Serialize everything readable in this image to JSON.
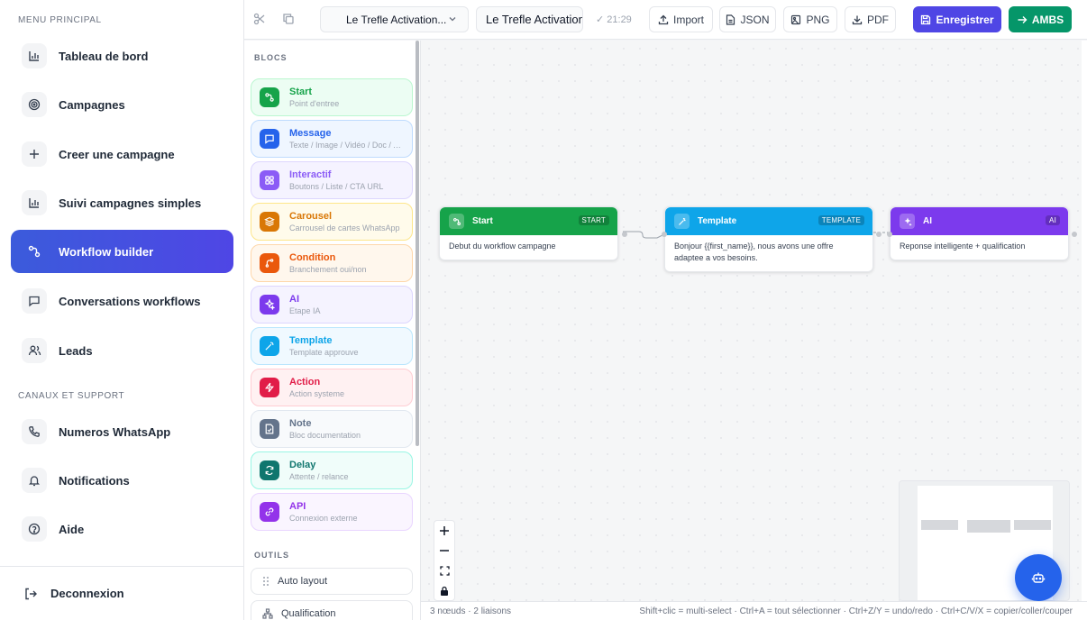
{
  "sidebar": {
    "main_section": "MENU PRINCIPAL",
    "support_section": "CANAUX ET SUPPORT",
    "items": [
      {
        "label": "Tableau de bord",
        "icon": "bar-chart-icon"
      },
      {
        "label": "Campagnes",
        "icon": "target-icon"
      },
      {
        "label": "Creer une campagne",
        "icon": "plus-icon"
      },
      {
        "label": "Suivi campagnes simples",
        "icon": "bar-chart-icon"
      },
      {
        "label": "Workflow builder",
        "icon": "workflow-icon",
        "active": true
      },
      {
        "label": "Conversations workflows",
        "icon": "chat-icon"
      },
      {
        "label": "Leads",
        "icon": "users-icon"
      }
    ],
    "support_items": [
      {
        "label": "Numeros WhatsApp",
        "icon": "phone-icon"
      },
      {
        "label": "Notifications",
        "icon": "bell-icon"
      },
      {
        "label": "Aide",
        "icon": "help-icon"
      }
    ],
    "logout": "Deconnexion"
  },
  "toolbar": {
    "workflow_select": "Le Trefle Activation...",
    "workflow_name": "Le Trefle Activation",
    "saved_time": "✓ 21:29",
    "import": "Import",
    "json": "JSON",
    "png": "PNG",
    "pdf": "PDF",
    "save": "Enregistrer",
    "ambs": "AMBS"
  },
  "panel": {
    "blocks_title": "BLOCS",
    "tools_title": "OUTILS",
    "blocks": [
      {
        "title": "Start",
        "sub": "Point d'entree",
        "color": "#16a34a",
        "bg": "#ecfdf3",
        "border": "#bbf7d0"
      },
      {
        "title": "Message",
        "sub": "Texte / Image / Vidéo / Doc / Audio",
        "color": "#2563eb",
        "bg": "#eff6ff",
        "border": "#bfdbfe"
      },
      {
        "title": "Interactif",
        "sub": "Boutons / Liste / CTA URL",
        "color": "#8b5cf6",
        "bg": "#f5f3ff",
        "border": "#ddd6fe"
      },
      {
        "title": "Carousel",
        "sub": "Carrousel de cartes WhatsApp",
        "color": "#d97706",
        "bg": "#fffbeb",
        "border": "#fde68a"
      },
      {
        "title": "Condition",
        "sub": "Branchement oui/non",
        "color": "#ea580c",
        "bg": "#fff7ed",
        "border": "#fed7aa"
      },
      {
        "title": "AI",
        "sub": "Etape IA",
        "color": "#7c3aed",
        "bg": "#f5f3ff",
        "border": "#ddd6fe"
      },
      {
        "title": "Template",
        "sub": "Template approuve",
        "color": "#0ea5e9",
        "bg": "#f0f9ff",
        "border": "#bae6fd"
      },
      {
        "title": "Action",
        "sub": "Action systeme",
        "color": "#e11d48",
        "bg": "#fff1f2",
        "border": "#fecdd3"
      },
      {
        "title": "Note",
        "sub": "Bloc documentation",
        "color": "#64748b",
        "bg": "#f8fafc",
        "border": "#e2e8f0"
      },
      {
        "title": "Delay",
        "sub": "Attente / relance",
        "color": "#0f766e",
        "bg": "#f0fdfa",
        "border": "#99f6e4"
      },
      {
        "title": "API",
        "sub": "Connexion externe",
        "color": "#9333ea",
        "bg": "#faf5ff",
        "border": "#e9d5ff"
      }
    ],
    "tools": [
      {
        "label": "Auto layout"
      },
      {
        "label": "Qualification"
      }
    ]
  },
  "nodes": [
    {
      "title": "Start",
      "tag": "START",
      "body": "Debut du workflow campagne",
      "color": "#16a34a"
    },
    {
      "title": "Template",
      "tag": "TEMPLATE",
      "body": "Bonjour {{first_name}}, nous avons une offre adaptee a vos besoins.",
      "color": "#0ea5e9"
    },
    {
      "title": "AI",
      "tag": "AI",
      "body": "Reponse intelligente + qualification",
      "color": "#7c3aed"
    }
  ],
  "status": {
    "counts": "3 nœuds · 2 liaisons",
    "shortcuts": "Shift+clic = multi-select · Ctrl+A = tout sélectionner · Ctrl+Z/Y = undo/redo · Ctrl+C/V/X = copier/coller/couper"
  }
}
